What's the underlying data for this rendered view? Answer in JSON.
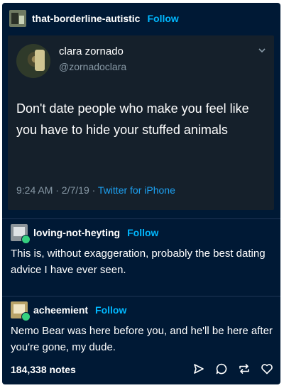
{
  "post": {
    "blog_name": "that-borderline-autistic",
    "follow_label": "Follow"
  },
  "tweet": {
    "display_name": "clara zornado",
    "handle": "@zornadoclara",
    "text": "Don't date people who make you feel like you have to hide your stuffed animals",
    "time": "9:24 AM · 2/7/19 · ",
    "source": "Twitter for iPhone"
  },
  "reblogs": [
    {
      "name": "loving-not-heyting",
      "follow_label": "Follow",
      "text": "This is, without exaggeration, probably the best dating advice I have ever seen."
    },
    {
      "name": "acheemient",
      "follow_label": "Follow",
      "text": "Nemo Bear was here before you, and he'll be here after you're gone, my dude."
    }
  ],
  "footer": {
    "notes": "184,338 notes"
  },
  "colors": {
    "background": "#001935",
    "tweet_bg": "#15202b",
    "accent": "#00b8ff",
    "twitter_blue": "#1da1f2"
  },
  "icons": [
    "chevron-down-icon",
    "share-icon",
    "reply-icon",
    "reblog-icon",
    "heart-icon"
  ]
}
